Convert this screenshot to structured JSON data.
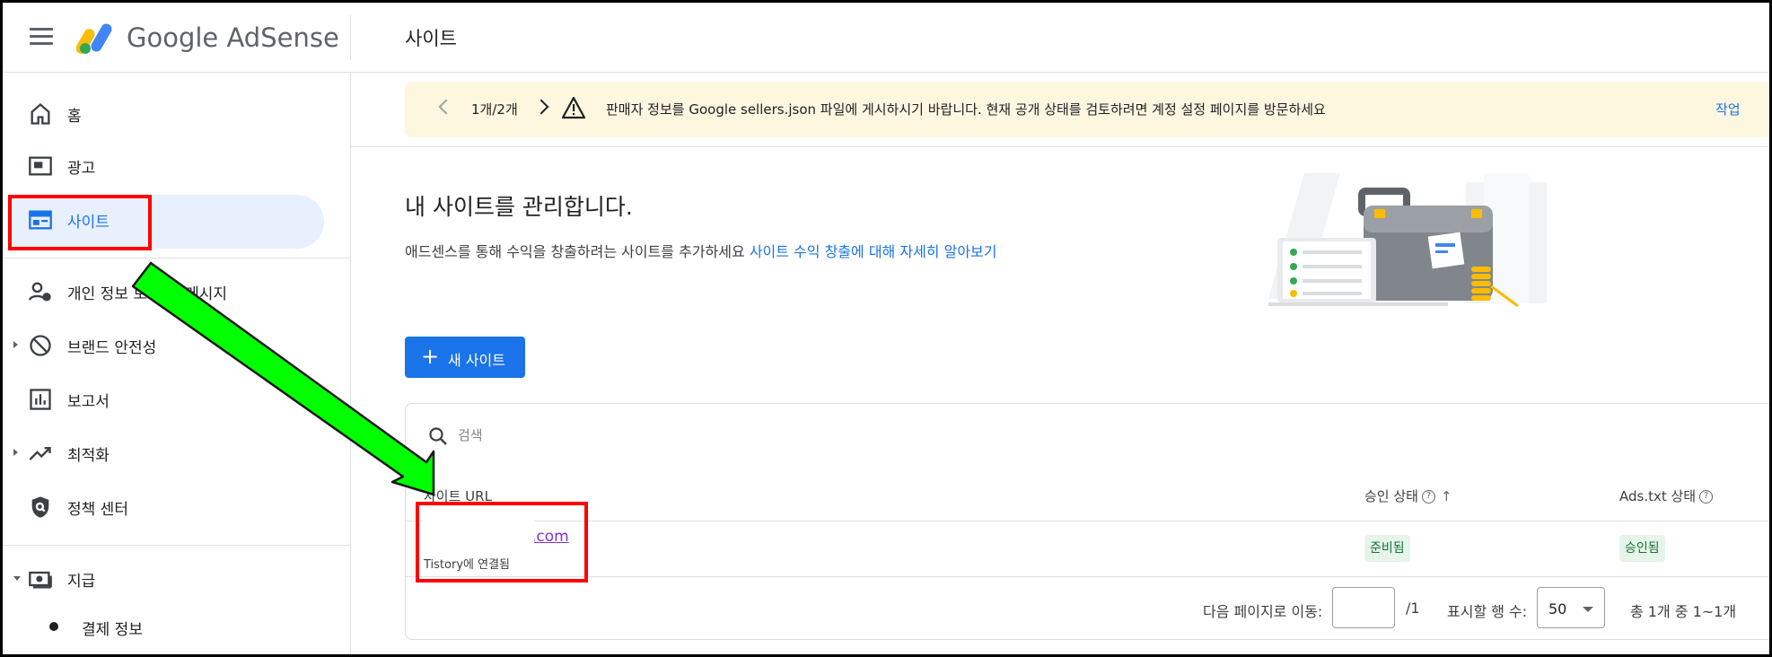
{
  "header": {
    "brand": "Google AdSense",
    "page_title": "사이트"
  },
  "sidebar": {
    "items": [
      {
        "label": "홈",
        "icon": "home-icon"
      },
      {
        "label": "광고",
        "icon": "ads-icon"
      },
      {
        "label": "사이트",
        "icon": "sites-icon",
        "active": true
      },
      {
        "label": "개인 정보 보호 및 메시지",
        "icon": "privacy-icon"
      },
      {
        "label": "브랜드 안전성",
        "icon": "block-icon"
      },
      {
        "label": "보고서",
        "icon": "report-icon"
      },
      {
        "label": "최적화",
        "icon": "trending-icon"
      },
      {
        "label": "정책 센터",
        "icon": "policy-icon"
      },
      {
        "label": "지급",
        "icon": "payments-icon"
      }
    ],
    "sub_items": [
      {
        "label": "결제 정보"
      }
    ]
  },
  "banner": {
    "pager": "1개/2개",
    "message": "판매자 정보를 Google sellers.json 파일에 게시하시기 바랍니다. 현재 공개 상태를 검토하려면 계정 설정 페이지를 방문하세요",
    "action": "작업"
  },
  "hero": {
    "title": "내 사이트를 관리합니다.",
    "subtitle": "애드센스를 통해 수익을 창출하려는 사이트를 추가하세요",
    "link": "사이트 수익 창출에 대해 자세히 알아보기"
  },
  "new_site_button": {
    "plus": "+",
    "label": "새 사이트"
  },
  "table": {
    "search_placeholder": "검색",
    "columns": {
      "site_url": "사이트 URL",
      "approval": "승인 상태",
      "ads_txt": "Ads.txt 상태"
    },
    "rows": [
      {
        "url": ".com",
        "source": "Tistory에 연결됨",
        "approval": "준비됨",
        "ads_txt": "승인됨"
      }
    ]
  },
  "footer": {
    "goto_label": "다음 페이지로 이동:",
    "page_total": "/1",
    "rows_label": "표시할 행 수:",
    "rows_value": "50",
    "count": "총 1개 중 1~1개"
  },
  "colors": {
    "accent": "#1a73e8",
    "highlight": "#ff0000",
    "annotation_arrow": "#00ff00",
    "banner_bg": "#fef7e0",
    "chip_bg": "#e6f4ea",
    "chip_text": "#137333"
  }
}
